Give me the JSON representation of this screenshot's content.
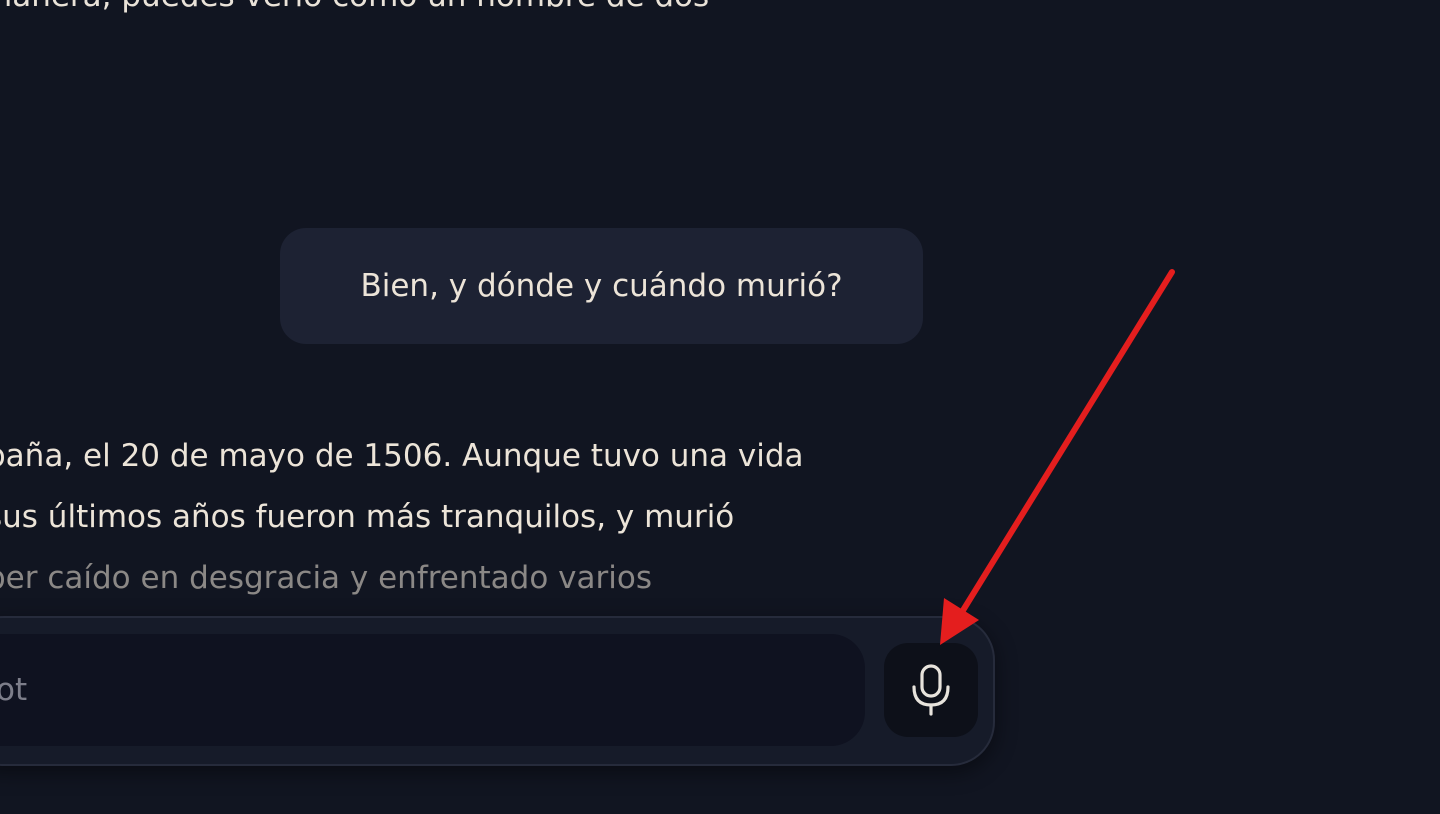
{
  "previous_message": {
    "last_line": "manera, puedes verlo como un nombre de dos"
  },
  "user_message": {
    "text": "Bien, y dónde y cuándo murió?"
  },
  "assistant_reply": {
    "lines": [
      "paña, el 20 de mayo de 1506. Aunque tuvo una vida",
      "sus últimos años fueron más tranquilos, y murió",
      "ber caído en desgracia y enfrentado varios"
    ]
  },
  "composer": {
    "placeholder_fragment": "ot",
    "mic_icon": "microphone-icon"
  },
  "annotation": {
    "arrow_color": "#e41e1e"
  },
  "colors": {
    "background": "#111521",
    "bubble": "#1d2233",
    "text": "#ece4d8"
  }
}
